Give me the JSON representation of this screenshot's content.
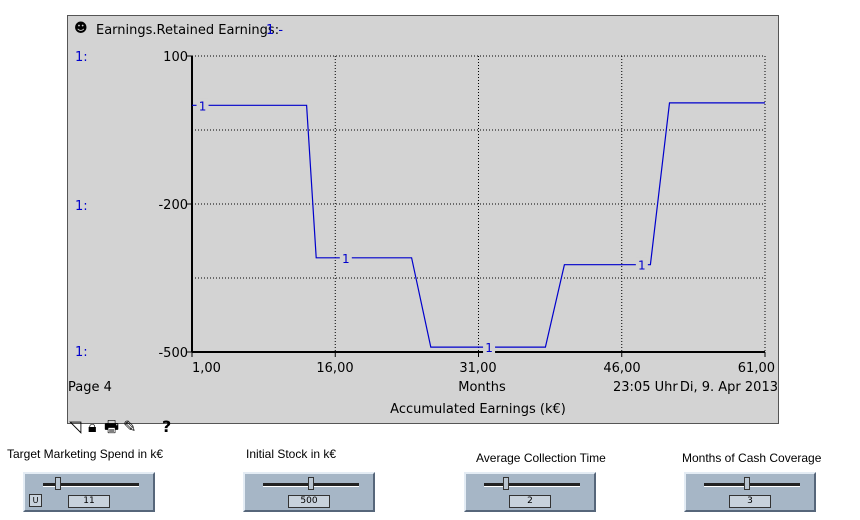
{
  "graph": {
    "series_title": "Earnings.Retained Earnings:",
    "series_suffix": "1 -",
    "axis_prefix": "1:",
    "y_ticks": [
      "100",
      "-200",
      "-500"
    ],
    "x_ticks": [
      "1,00",
      "16,00",
      "31,00",
      "46,00",
      "61,00"
    ],
    "x_unit": "Months",
    "page_label": "Page 4",
    "time_label": "23:05 Uhr",
    "date_label": "Di, 9. Apr 2013",
    "subtitle": "Accumulated Earnings (k€)",
    "help_label": "?"
  },
  "chart_data": {
    "type": "line",
    "title": "Earnings.Retained Earnings",
    "xlabel": "Months",
    "ylabel": "",
    "xlim": [
      1,
      61
    ],
    "ylim": [
      -500,
      100
    ],
    "grid": true,
    "series": [
      {
        "name": "1",
        "color": "#0000cc",
        "x": [
          1,
          13,
          14,
          24,
          26,
          38,
          40,
          49,
          51,
          61
        ],
        "y": [
          0,
          0,
          -309,
          -309,
          -490,
          -490,
          -323,
          -323,
          5,
          5
        ],
        "marker_x": [
          2,
          17,
          32,
          48
        ],
        "marker_y": [
          0,
          -309,
          -490,
          -323
        ],
        "marker_label": "1"
      }
    ]
  },
  "sliders": [
    {
      "label": "Target Marketing Spend in k€",
      "value": "11",
      "fraction": 0.16,
      "has_u_button": true,
      "u_label": "U"
    },
    {
      "label": "Initial Stock in k€",
      "value": "500",
      "fraction": 0.5,
      "has_u_button": false
    },
    {
      "label": "Average Collection Time",
      "value": "2",
      "fraction": 0.23,
      "has_u_button": false
    },
    {
      "label": "Months of Cash Coverage",
      "value": "3",
      "fraction": 0.45,
      "has_u_button": false
    }
  ],
  "colors": {
    "plot_bg": "#d3d3d3",
    "series": "#0000cc",
    "slider_bg": "#a6b6c6"
  }
}
